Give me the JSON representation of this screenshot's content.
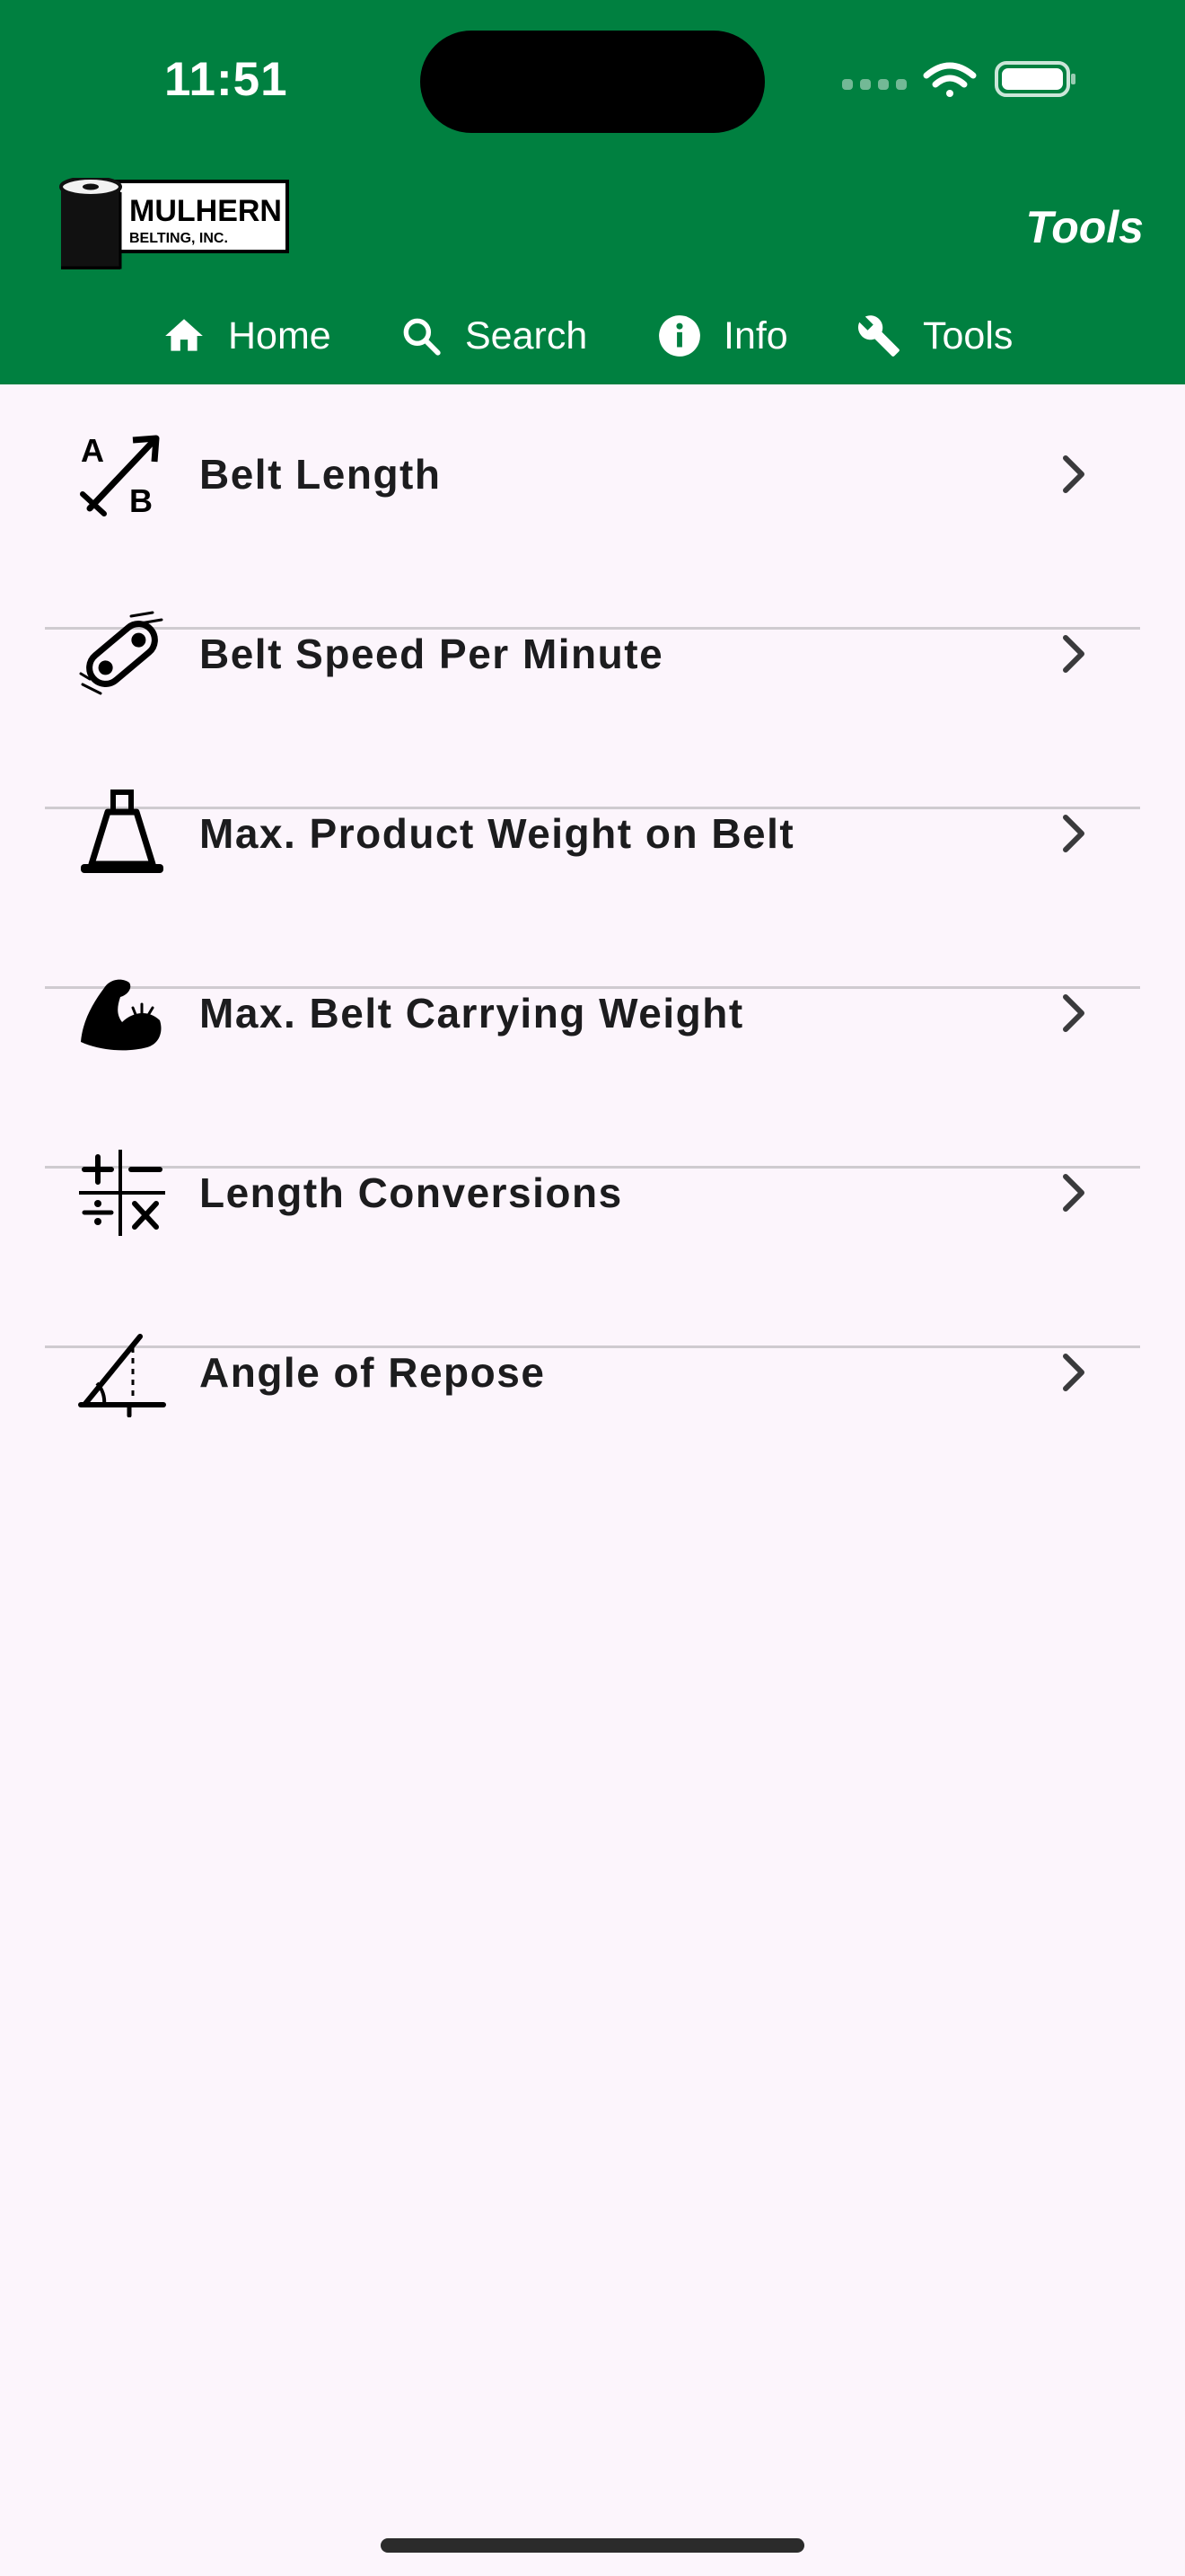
{
  "status_bar": {
    "time": "11:51"
  },
  "header": {
    "logo": {
      "line1": "MULHERN",
      "line2": "BELTING, INC."
    },
    "title": "Tools",
    "bg_color": "#008040"
  },
  "nav": {
    "items": [
      {
        "label": "Home",
        "icon": "home-icon"
      },
      {
        "label": "Search",
        "icon": "search-icon"
      },
      {
        "label": "Info",
        "icon": "info-icon"
      },
      {
        "label": "Tools",
        "icon": "wrench-icon"
      }
    ]
  },
  "tools": {
    "items": [
      {
        "label": "Belt Length",
        "icon": "ab-arrow-icon"
      },
      {
        "label": "Belt Speed Per Minute",
        "icon": "belt-speed-icon"
      },
      {
        "label": "Max. Product Weight on Belt",
        "icon": "weight-icon"
      },
      {
        "label": "Max. Belt Carrying Weight",
        "icon": "flexed-arm-icon"
      },
      {
        "label": "Length Conversions",
        "icon": "math-operators-icon"
      },
      {
        "label": "Angle of Repose",
        "icon": "angle-icon"
      }
    ]
  },
  "colors": {
    "accent": "#008040",
    "background": "#fcf5fc",
    "text": "#1c1c1e"
  }
}
